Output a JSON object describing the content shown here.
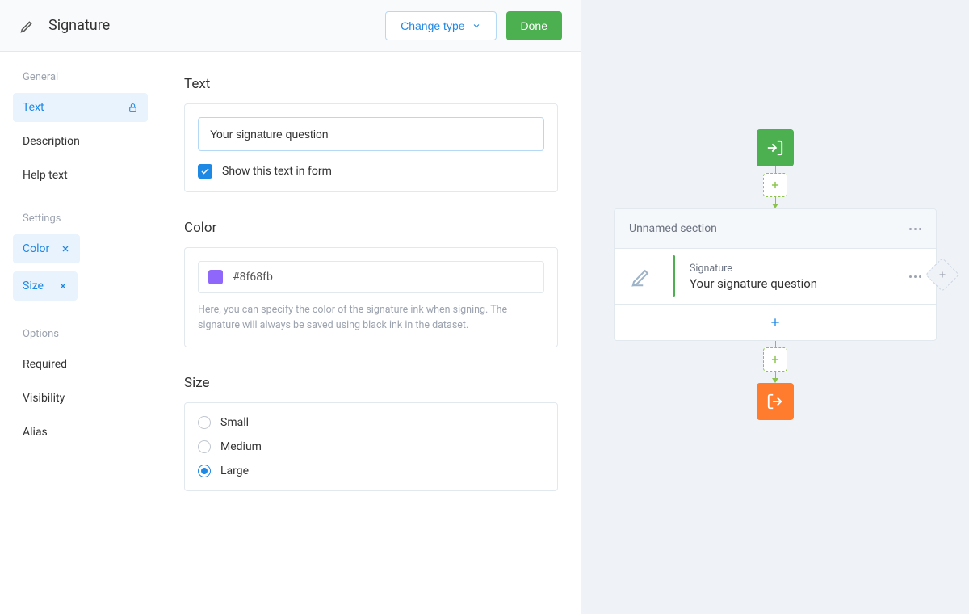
{
  "header": {
    "title": "Signature",
    "change_type": "Change type",
    "done": "Done"
  },
  "sidebar": {
    "groups": [
      {
        "title": "General",
        "items": [
          {
            "label": "Text",
            "active": true,
            "icon": "lock"
          },
          {
            "label": "Description"
          },
          {
            "label": "Help text"
          }
        ]
      },
      {
        "title": "Settings",
        "items": [
          {
            "label": "Color",
            "active": true,
            "icon": "x"
          },
          {
            "label": "Size",
            "active": true,
            "icon": "x"
          }
        ]
      },
      {
        "title": "Options",
        "items": [
          {
            "label": "Required"
          },
          {
            "label": "Visibility"
          },
          {
            "label": "Alias"
          }
        ]
      }
    ]
  },
  "text_section": {
    "title": "Text",
    "value": "Your signature question",
    "checkbox_label": "Show this text in form",
    "checked": true
  },
  "color_section": {
    "title": "Color",
    "value": "#8f68fb",
    "help": "Here, you can specify the color of the signature ink when signing. The signature will always be saved using black ink in the dataset."
  },
  "size_section": {
    "title": "Size",
    "options": [
      "Small",
      "Medium",
      "Large"
    ],
    "selected": "Large"
  },
  "preview": {
    "section_title": "Unnamed section",
    "field_type": "Signature",
    "field_label": "Your signature question"
  }
}
